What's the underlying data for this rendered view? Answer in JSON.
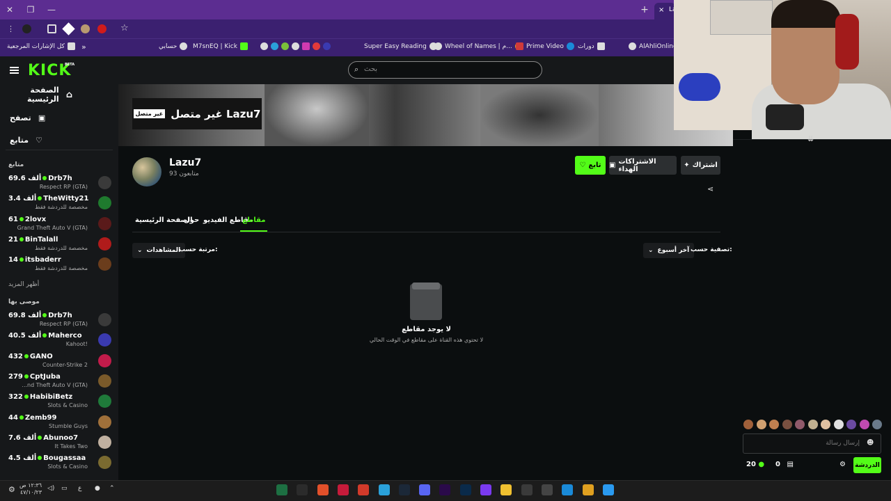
{
  "browser": {
    "tab_title": "La",
    "tab_close": "×",
    "new_tab": "+",
    "window_close": "✕",
    "window_restore": "❐",
    "window_minimize": "—",
    "bookmarks": [
      {
        "label": "كل الإشارات المرجعية"
      },
      {
        "label": "حسابي"
      },
      {
        "label": "M7snEQ | Kick"
      },
      {
        "label": "Super Easy Reading"
      },
      {
        "label": "Wheel of Names | م..."
      },
      {
        "label": "Prime Video"
      },
      {
        "label": "دورات"
      },
      {
        "label": "AlAhliOnline"
      }
    ],
    "bookmarks_more": "»"
  },
  "nav": {
    "logo": "KICK",
    "beta": "BETA",
    "search_placeholder": "بحث"
  },
  "sidebar": {
    "menu": [
      {
        "label": "الصفحة الرئيسية",
        "icon": "home-icon"
      },
      {
        "label": "تصفح",
        "icon": "browse-icon"
      },
      {
        "label": "متابع",
        "icon": "heart-icon"
      }
    ],
    "following_header": "متابع",
    "following": [
      {
        "name": "Drb7h",
        "viewers": "69.6 ألف",
        "category": "Respect RP (GTA)",
        "color": "#3a3a3a"
      },
      {
        "name": "TheWitty21",
        "viewers": "3.4 ألف",
        "category": "مخصصة للدردشة فقط",
        "color": "#1f7a2e"
      },
      {
        "name": "2lovx",
        "viewers": "61",
        "category": "Grand Theft Auto V (GTA)",
        "color": "#5a1a1a"
      },
      {
        "name": "BinTalall",
        "viewers": "21",
        "category": "مخصصة للدردشة فقط",
        "color": "#b01b1b"
      },
      {
        "name": "itsbaderr",
        "viewers": "14",
        "category": "مخصصة للدردشة فقط",
        "color": "#6b3d1c"
      }
    ],
    "show_more": "أظهر المزيد",
    "recommended_header": "موصى بها",
    "recommended": [
      {
        "name": "Drb7h",
        "viewers": "69.8 ألف",
        "category": "Respect RP (GTA)",
        "color": "#3a3a3a"
      },
      {
        "name": "Maherco",
        "viewers": "40.5 ألف",
        "category": "Kahoot!",
        "color": "#3a3ab0"
      },
      {
        "name": "GANO",
        "viewers": "432",
        "category": "Counter-Strike 2",
        "color": "#c21b4a"
      },
      {
        "name": "CptJuba",
        "viewers": "279",
        "category": "...nd Theft Auto V (GTA)",
        "color": "#7a5a2a"
      },
      {
        "name": "HabibiBetz",
        "viewers": "322",
        "category": "Slots & Casino",
        "color": "#1f7a3a"
      },
      {
        "name": "Zemb99",
        "viewers": "44",
        "category": "Stumble Guys",
        "color": "#a0703a"
      },
      {
        "name": "Abunoo7",
        "viewers": "7.6 ألف",
        "category": "It Takes Two",
        "color": "#c0b0a0"
      },
      {
        "name": "Bougassaa",
        "viewers": "4.5 ألف",
        "category": "Slots & Casino",
        "color": "#7a6a30"
      }
    ]
  },
  "channel": {
    "offline_badge": "غير متصل",
    "offline_title": "غير متصل Lazu7",
    "name": "Lazu7",
    "followers": "93 متابعون",
    "follow_button": "تابع",
    "gift_button": "الاشتراكات الهداء",
    "subscribe_button": "اشتراك",
    "tabs": [
      {
        "label": "الصفحة الرئيسية",
        "active": false
      },
      {
        "label": "حول",
        "active": false
      },
      {
        "label": "مقاطع الفيديو",
        "active": false
      },
      {
        "label": "مقاطع",
        "active": true
      }
    ],
    "filter_label": "تصفية حسب:",
    "filter_value": "آخر أسبوع",
    "sort_label": "مرتبة حسب:",
    "sort_value": "المشاهدات",
    "empty_title": "لا يوجد مقاطع",
    "empty_subtitle": "لا تحتوي هذه القناة على مقاطع في الوقت الحالي"
  },
  "chat": {
    "input_placeholder": "إرسال رسالة",
    "send_button": "الدردشة",
    "kicks_count": "0",
    "points_count": "20",
    "chatter_colors": [
      "#a0603a",
      "#d0a070",
      "#c08050",
      "#7a5040",
      "#905a6a",
      "#c0b090",
      "#e0c0a0",
      "#e0e0e0",
      "#6a4aa0",
      "#c04ab0",
      "#6a7a8a"
    ]
  },
  "taskbar": {
    "time": "١٢:٣٦ ص",
    "date": "٤٧/١٠/٢٣",
    "lang": "ع",
    "apps": [
      {
        "name": "excel-icon",
        "color": "#1d6f42"
      },
      {
        "name": "terminal-icon",
        "color": "#2b2b2b"
      },
      {
        "name": "brave-icon",
        "color": "#e2502a"
      },
      {
        "name": "app-a-icon",
        "color": "#c51b3a"
      },
      {
        "name": "app-red-icon",
        "color": "#d23a2a"
      },
      {
        "name": "telegram-icon",
        "color": "#2aa1da"
      },
      {
        "name": "steam-icon",
        "color": "#1b2838"
      },
      {
        "name": "discord-icon",
        "color": "#5865f2"
      },
      {
        "name": "premiere-icon",
        "color": "#2a0a4a"
      },
      {
        "name": "photoshop-icon",
        "color": "#0a2a4a"
      },
      {
        "name": "app-purple-icon",
        "color": "#7a3af0"
      },
      {
        "name": "folder-icon",
        "color": "#f0c030"
      },
      {
        "name": "store-icon",
        "color": "#3a3a3a"
      },
      {
        "name": "app-sphere-icon",
        "color": "#444"
      },
      {
        "name": "edge-icon",
        "color": "#1a8ad8"
      },
      {
        "name": "chrome-icon",
        "color": "#e0a020"
      },
      {
        "name": "windows-icon",
        "color": "#2a9af0"
      }
    ]
  }
}
